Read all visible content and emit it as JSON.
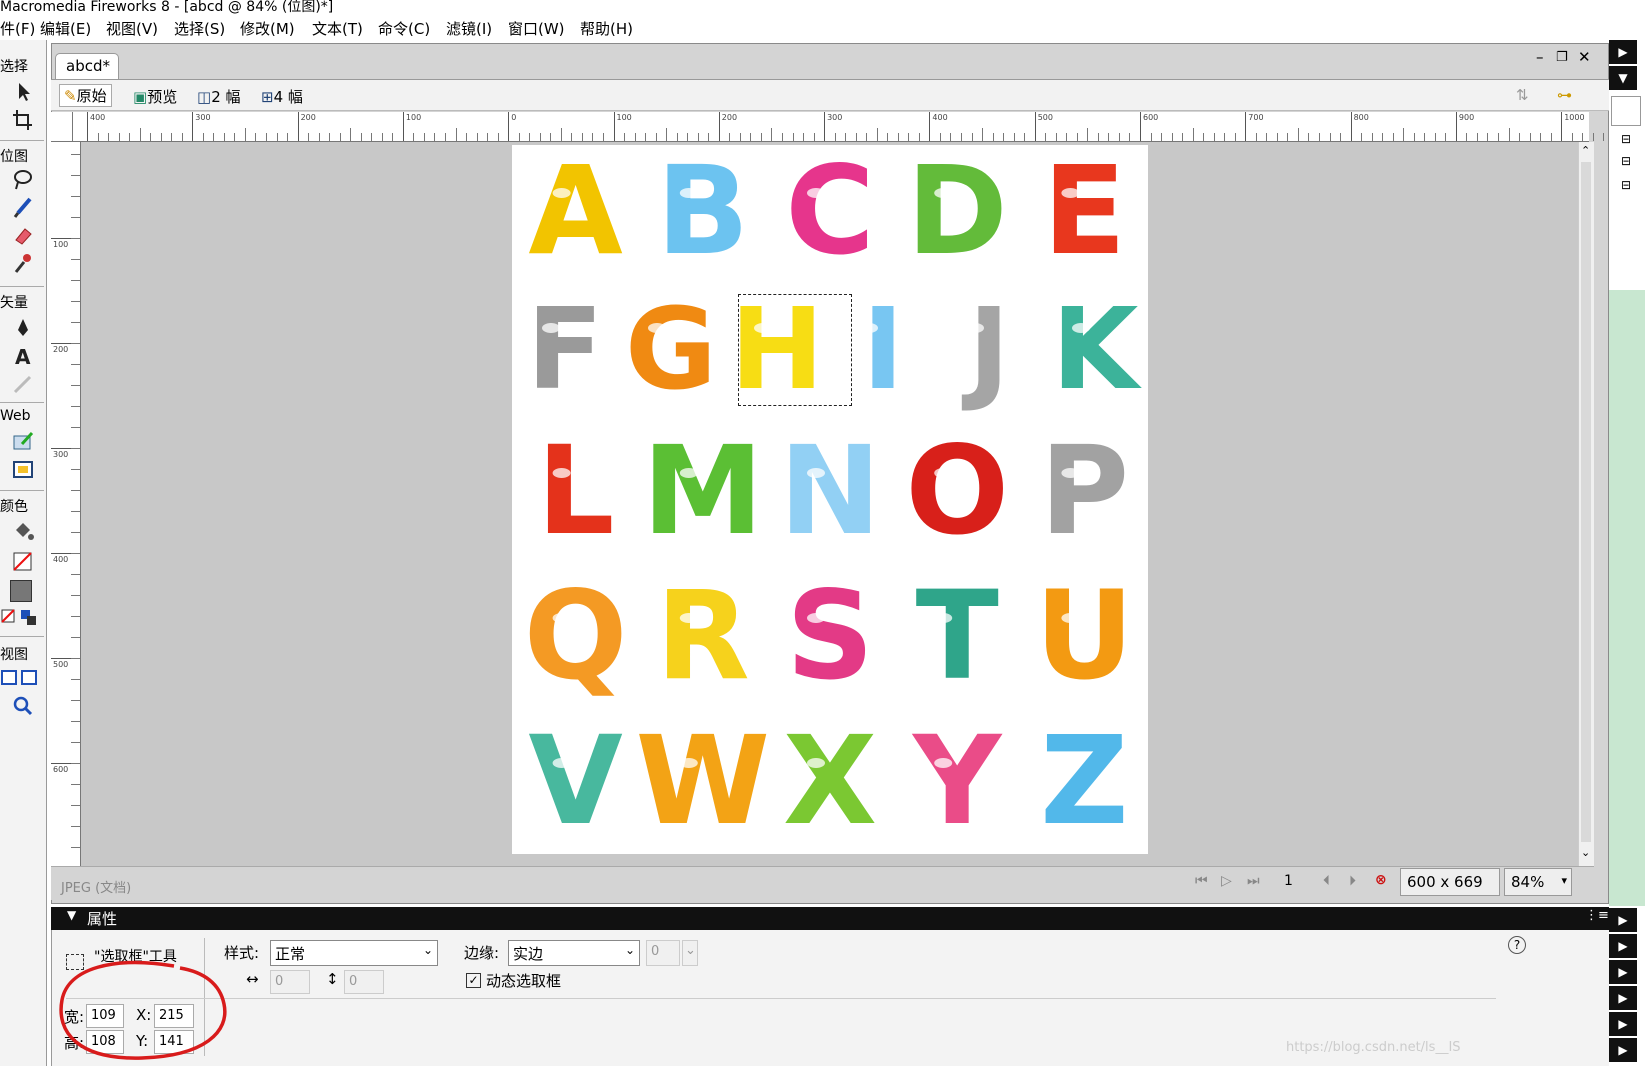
{
  "title": "Macromedia Fireworks 8 - [abcd @ 84% (位图)*]",
  "menu": [
    "件(F)",
    "编辑(E)",
    "视图(V)",
    "选择(S)",
    "修改(M)",
    "文本(T)",
    "命令(C)",
    "滤镜(I)",
    "窗口(W)",
    "帮助(H)"
  ],
  "tools": {
    "sections": [
      "选择",
      "位图",
      "矢量",
      "Web",
      "颜色",
      "视图"
    ]
  },
  "document": {
    "tab": "abcd*",
    "views": [
      "原始",
      "预览",
      "2 幅",
      "4 幅"
    ],
    "hruler_labels": [
      "400",
      "300",
      "200",
      "100",
      "0",
      "100",
      "200",
      "300",
      "400",
      "500",
      "600",
      "700",
      "800",
      "900",
      "1000"
    ],
    "vruler_labels": [
      "100",
      "200",
      "300",
      "400",
      "500",
      "600"
    ],
    "letters": [
      "A",
      "B",
      "C",
      "D",
      "E",
      "F",
      "G",
      "H",
      "I",
      "J",
      "K",
      "L",
      "M",
      "N",
      "O",
      "P",
      "Q",
      "R",
      "S",
      "T",
      "U",
      "V",
      "W",
      "X",
      "Y",
      "Z"
    ],
    "letter_colors": [
      "#f2c400",
      "#6cc3f0",
      "#e6358c",
      "#63bb3a",
      "#e8371e",
      "#9a9a9a",
      "#f08a12",
      "#f7dd14",
      "#78c6f2",
      "#a5a5a5",
      "#3cb39a",
      "#e4321b",
      "#5bbf34",
      "#92d0f4",
      "#d8201a",
      "#a2a2a2",
      "#f49a24",
      "#f6d21c",
      "#e33a86",
      "#2fa58a",
      "#f39a12",
      "#48b89e",
      "#f3a315",
      "#7bc832",
      "#ea4c88",
      "#52b8ea"
    ],
    "selected_letter": "H"
  },
  "status": {
    "format": "JPEG (文档)",
    "frame": "1",
    "size": "600 x 669",
    "zoom": "84%"
  },
  "properties": {
    "header": "属性",
    "tool_name": "\"选取框\"工具",
    "style_label": "样式:",
    "style_value": "正常",
    "edge_label": "边缘:",
    "edge_value": "实边",
    "edge_amount": "0",
    "fixed_w": "0",
    "fixed_h": "0",
    "dynamic_label": "动态选取框",
    "dynamic_checked": true,
    "w_label": "宽:",
    "w_value": "109",
    "h_label": "高:",
    "h_value": "108",
    "x_label": "X:",
    "x_value": "215",
    "y_label": "Y:",
    "y_value": "141",
    "help": "?"
  },
  "watermark": "https://blog.csdn.net/ls__IS",
  "colors": {
    "annotation": "#d81b1b",
    "titlebar": "#ffffff",
    "panel_header": "#111111",
    "canvas_bg": "#c8c8c8"
  }
}
